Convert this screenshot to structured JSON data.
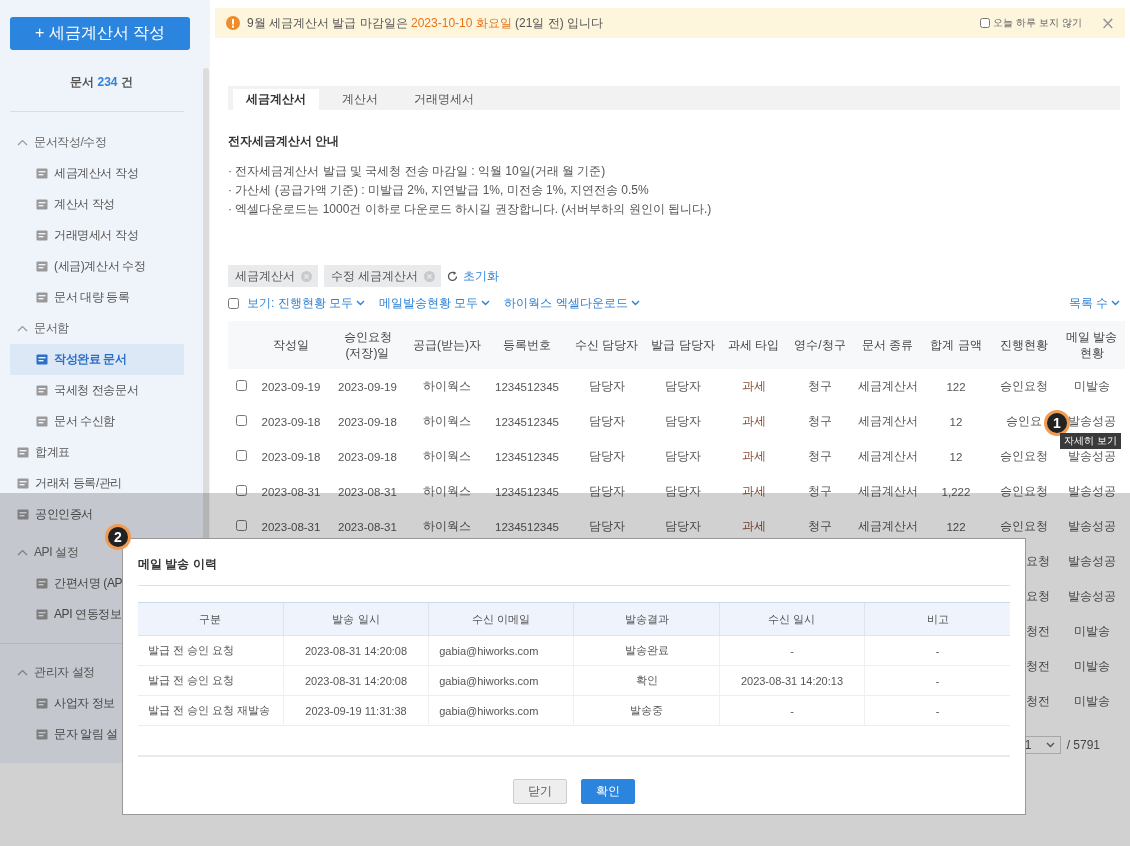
{
  "sidebar": {
    "create_button": "+ 세금계산서 작성",
    "doc_count": {
      "prefix": "문서",
      "count": "234",
      "suffix": "건"
    },
    "nav": [
      {
        "kind": "group",
        "label": "문서작성/수정",
        "expanded": true,
        "children": [
          {
            "label": "세금계산서 작성",
            "selected": false
          },
          {
            "label": "계산서 작성",
            "selected": false
          },
          {
            "label": "거래명세서 작성",
            "selected": false
          },
          {
            "label": "(세금)계산서 수정",
            "selected": false
          },
          {
            "label": "문서 대량 등록",
            "selected": false
          }
        ]
      },
      {
        "kind": "group",
        "label": "문서함",
        "expanded": true,
        "children": [
          {
            "label": "작성완료 문서",
            "selected": true
          },
          {
            "label": "국세청 전송문서",
            "selected": false
          },
          {
            "label": "문서 수신함",
            "selected": false
          }
        ]
      },
      {
        "kind": "link",
        "label": "합계표",
        "selected": false
      },
      {
        "kind": "link",
        "label": "거래처 등록/관리",
        "selected": false
      },
      {
        "kind": "link",
        "label": "공인인증서",
        "selected": false
      },
      {
        "kind": "group",
        "label": "API 설정",
        "expanded": true,
        "children": [
          {
            "label": "간편서명 (AP",
            "selected": false
          },
          {
            "label": "API 연동정보",
            "selected": false
          }
        ]
      },
      {
        "kind": "divider"
      },
      {
        "kind": "group",
        "label": "관리자 설정",
        "expanded": true,
        "children": [
          {
            "label": "사업자 정보",
            "selected": false
          },
          {
            "label": "문자 알림 설",
            "selected": false
          }
        ]
      }
    ]
  },
  "notice": {
    "prefix": "9월 세금계산서 발급 마감일은 ",
    "highlight": "2023-10-10 화요일",
    "suffix": " (21일 전) 입니다",
    "hide_today": {
      "label": "오늘 하루 보지 않기",
      "checked": false
    },
    "close": "×"
  },
  "tabs": [
    {
      "label": "세금계산서",
      "selected": true
    },
    {
      "label": "계산서",
      "selected": false
    },
    {
      "label": "거래명세서",
      "selected": false
    }
  ],
  "guide": {
    "title": "전자세금계산서 안내",
    "lines": [
      "· 전자세금계산서 발급 및 국세청 전송 마감일 : 익월 10일(거래 월 기준)",
      "· 가산세 (공급가액 기준) : 미발급 2%, 지연발급 1%, 미전송 1%, 지연전송 0.5%",
      "· 엑셀다운로드는 1000건 이하로 다운로드 하시길 권장합니다. (서버부하의 원인이 됩니다.)"
    ]
  },
  "filters": {
    "chips": [
      "세금계산서",
      "수정 세금계산서"
    ],
    "reset": "초기화",
    "select_all": {
      "checked": false
    },
    "dropdowns": [
      "보기: 진행현황 모두",
      "메일발송현황 모두",
      "하이웍스 엑셀다운로드"
    ],
    "page_size": "목록 수"
  },
  "table": {
    "columns": [
      "작성일",
      "승인요청\n(저장)일",
      "공급(받는)자",
      "등록번호",
      "수신 담당자",
      "발급 담당자",
      "과세 타입",
      "영수/청구",
      "문서 종류",
      "합계 금액",
      "진행현황",
      "메일 발송\n현황"
    ],
    "rows": [
      {
        "kind": "full",
        "checked": false,
        "cells": [
          "2023-09-19",
          "2023-09-19",
          "하이웍스",
          "1234512345",
          "담당자",
          "담당자",
          "과세",
          "청구",
          "세금계산서",
          "122",
          "승인요청",
          "미발송"
        ]
      },
      {
        "kind": "full",
        "checked": false,
        "cells": [
          "2023-09-18",
          "2023-09-18",
          "하이웍스",
          "1234512345",
          "담당자",
          "담당자",
          "과세",
          "청구",
          "세금계산서",
          "12",
          "승인요",
          "발송성공"
        ]
      },
      {
        "kind": "full",
        "checked": false,
        "cells": [
          "2023-09-18",
          "2023-09-18",
          "하이웍스",
          "1234512345",
          "담당자",
          "담당자",
          "과세",
          "청구",
          "세금계산서",
          "12",
          "승인요청",
          "발송성공"
        ]
      },
      {
        "kind": "full",
        "checked": false,
        "cells": [
          "2023-08-31",
          "2023-08-31",
          "하이웍스",
          "1234512345",
          "담당자",
          "담당자",
          "과세",
          "청구",
          "세금계산서",
          "1,222",
          "승인요청",
          "발송성공"
        ]
      },
      {
        "kind": "full",
        "checked": false,
        "cells": [
          "2023-08-31",
          "2023-08-31",
          "하이웍스",
          "1234512345",
          "담당자",
          "담당자",
          "과세",
          "청구",
          "세금계산서",
          "122",
          "승인요청",
          "발송성공"
        ]
      },
      {
        "kind": "partial",
        "cells": [
          "요청",
          "발송성공"
        ]
      },
      {
        "kind": "partial",
        "cells": [
          "요청",
          "발송성공"
        ]
      },
      {
        "kind": "partial",
        "cells": [
          "청전",
          "미발송"
        ]
      },
      {
        "kind": "partial",
        "cells": [
          "청전",
          "미발송"
        ]
      },
      {
        "kind": "partial",
        "cells": [
          "청전",
          "미발송"
        ]
      }
    ]
  },
  "pagination": {
    "page": "1",
    "total": "/ 5791"
  },
  "callouts": [
    {
      "label": "1",
      "tooltip": "자세히 보기"
    },
    {
      "label": "2"
    }
  ],
  "modal": {
    "title": "메일 발송 이력",
    "columns": [
      "구분",
      "발송 일시",
      "수신 이메일",
      "발송결과",
      "수신 일시",
      "비고"
    ],
    "rows": [
      [
        "발급 전 승인 요청",
        "2023-08-31 14:20:08",
        "gabia@hiworks.com",
        "발송완료",
        "-",
        "-"
      ],
      [
        "발급 전 승인 요청",
        "2023-08-31 14:20:08",
        "gabia@hiworks.com",
        "확인",
        "2023-08-31 14:20:13",
        "-"
      ],
      [
        "발급 전 승인 요청 재발송",
        "2023-09-19 11:31:38",
        "gabia@hiworks.com",
        "발송중",
        "-",
        "-"
      ]
    ],
    "buttons": [
      {
        "label": "닫기",
        "kind": "secondary"
      },
      {
        "label": "확인",
        "kind": "primary"
      }
    ]
  }
}
